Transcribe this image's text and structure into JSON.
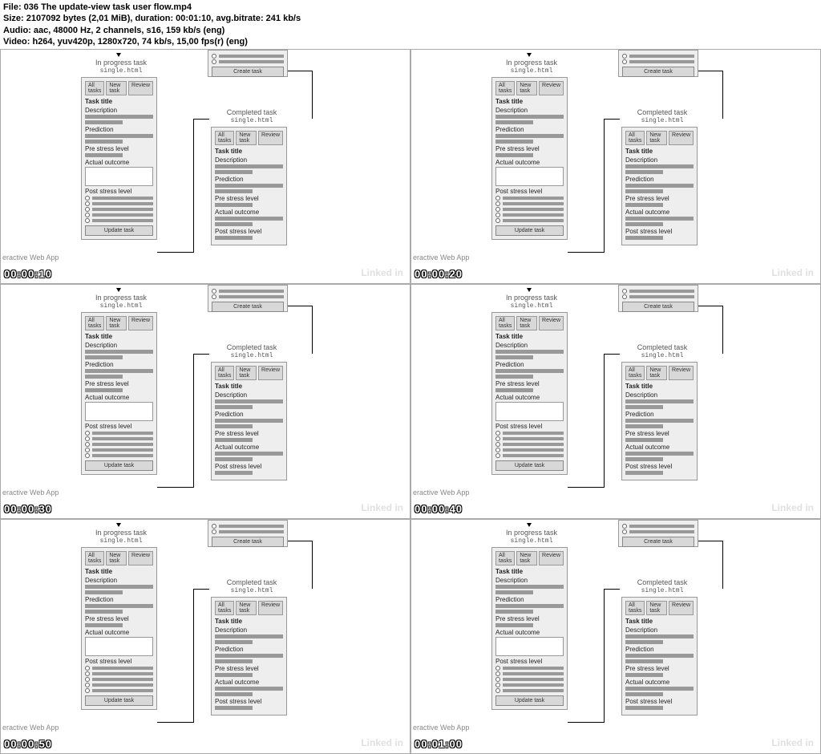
{
  "meta": {
    "file": "File: 036 The update-view task user flow.mp4",
    "size": "Size: 2107092 bytes (2,01 MiB), duration: 00:01:10, avg.bitrate: 241 kb/s",
    "audio": "Audio: aac, 48000 Hz, 2 channels, s16, 159 kb/s (eng)",
    "video": "Video: h264, yuv420p, 1280x720, 74 kb/s, 15,00 fps(r) (eng)"
  },
  "watermark": "Linked in",
  "app_label": "eractive Web App",
  "timestamps": [
    "00:00:10",
    "00:00:20",
    "00:00:30",
    "00:00:40",
    "00:00:50",
    "00:01:00"
  ],
  "card_in_progress": {
    "header": "In progress task",
    "sub": "single.html",
    "tabs": [
      "All tasks",
      "New task",
      "Review"
    ],
    "task_title": "Task title",
    "description": "Description",
    "prediction": "Prediction",
    "pre_stress": "Pre stress level",
    "actual_outcome": "Actual outcome",
    "post_stress": "Post stress level",
    "btn": "Update task"
  },
  "card_completed": {
    "header": "Completed task",
    "sub": "single.html",
    "tabs": [
      "All tasks",
      "New task",
      "Review"
    ],
    "task_title": "Task title",
    "description": "Description",
    "prediction": "Prediction",
    "pre_stress": "Pre stress level",
    "actual_outcome": "Actual outcome",
    "post_stress": "Post stress level"
  },
  "card_create": {
    "btn": "Create task"
  }
}
